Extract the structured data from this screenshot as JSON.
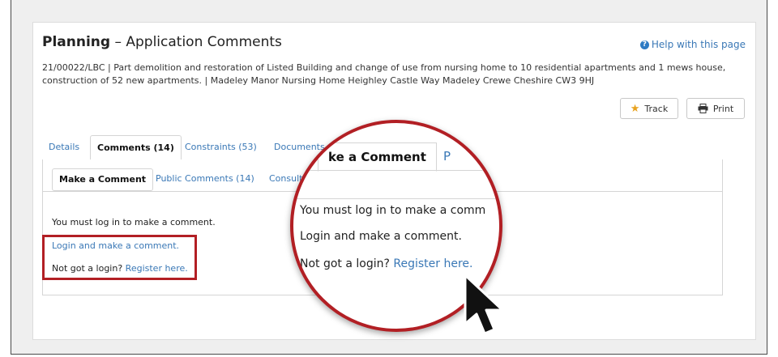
{
  "header": {
    "title_bold": "Planning",
    "title_rest": " – Application Comments",
    "help_label": "Help with this page"
  },
  "application": {
    "description": "21/00022/LBC | Part demolition and restoration of Listed Building and change of use from nursing home to 10 residential apartments and 1 mews house, construction of 52 new apartments. | Madeley Manor Nursing Home Heighley Castle Way Madeley Crewe Cheshire CW3 9HJ"
  },
  "toolbar": {
    "track_label": "Track",
    "print_label": "Print"
  },
  "tabs": [
    {
      "label": "Details"
    },
    {
      "label": "Comments (14)"
    },
    {
      "label": "Constraints (53)"
    },
    {
      "label": "Documents"
    }
  ],
  "subtabs": [
    {
      "label": "Make a Comment"
    },
    {
      "label": "Public Comments (14)"
    },
    {
      "label": "Consulte"
    }
  ],
  "comment_panel": {
    "must_login": "You must log in to make a comment.",
    "login_link": "Login and make a comment.",
    "not_got_login": "Not got a login?",
    "register_link": "Register here."
  },
  "magnifier": {
    "tab_label": "ke a Comment",
    "must_login": "You must log in to make a comm",
    "login_link": "Login and make a comment.",
    "not_got_login": "Not got a login?",
    "register_link": "Register here."
  },
  "colors": {
    "accent_red": "#b21f24",
    "link_blue": "#3a78b6",
    "star": "#e8a21e"
  }
}
